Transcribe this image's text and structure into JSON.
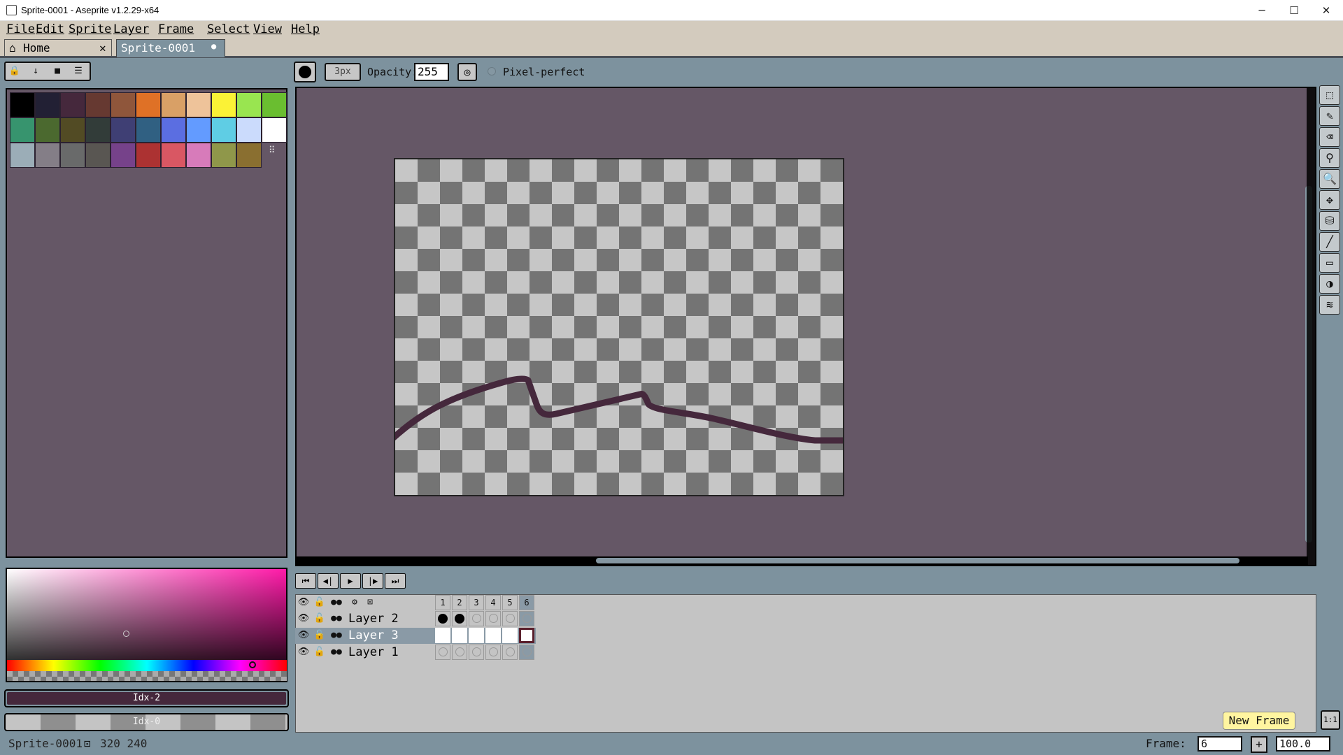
{
  "window": {
    "title": "Sprite-0001 - Aseprite v1.2.29-x64",
    "minimize": "─",
    "maximize": "☐",
    "close": "✕"
  },
  "menu": [
    "File",
    "Edit",
    "Sprite",
    "Layer",
    "Frame",
    "Select",
    "View",
    "Help"
  ],
  "tabs": [
    {
      "label": "Home",
      "icon": "home-icon",
      "close": "✕"
    },
    {
      "label": "Sprite-0001",
      "modified": "●"
    }
  ],
  "toolbar": {
    "brush_size": "3px",
    "opacity_label": "Opacity:",
    "opacity_value": "255",
    "pixel_perfect_label": "Pixel-perfect"
  },
  "palette": {
    "colors": [
      "#000000",
      "#222034",
      "#45283c",
      "#663931",
      "#8f563b",
      "#df7126",
      "#d9a066",
      "#eec39a",
      "#fbf236",
      "#99e550",
      "#6abe30",
      "#37946e",
      "#4b692f",
      "#524b24",
      "#323c39",
      "#3f3f74",
      "#306082",
      "#5b6ee1",
      "#639bff",
      "#5fcde4",
      "#cbdbfc",
      "#ffffff",
      "#9badb7",
      "#847e87",
      "#696a6a",
      "#595652",
      "#76428a",
      "#ac3232",
      "#d95763",
      "#d77bba",
      "#8f974a",
      "#8a6f30"
    ],
    "options_glyph": "⠿"
  },
  "color_bars": {
    "fg_label": "Idx-2",
    "bg_label": "Idx-0",
    "fg_color": "#45283c"
  },
  "timeline": {
    "controls": [
      "⏮",
      "◀|",
      "▶",
      "|▶",
      "⏭"
    ],
    "frames": [
      "1",
      "2",
      "3",
      "4",
      "5",
      "6"
    ],
    "layers": [
      {
        "name": "Layer 2",
        "cels": [
          "filled",
          "filled",
          "empty",
          "empty",
          "empty",
          "empty"
        ]
      },
      {
        "name": "Layer 3",
        "cels": [
          "linked",
          "linked",
          "linked",
          "linked",
          "linked",
          "linked"
        ],
        "selected": true
      },
      {
        "name": "Layer 1",
        "cels": [
          "empty",
          "empty",
          "empty",
          "empty",
          "empty",
          "empty"
        ]
      }
    ]
  },
  "tooltip": "New Frame",
  "status": {
    "sprite": "Sprite-0001",
    "size": "320 240",
    "frame_label": "Frame:",
    "frame_value": "6",
    "zoom": "100.0",
    "new_frame_glyph": "+",
    "ratio": "1:1"
  },
  "tools": [
    "marquee-icon",
    "pencil-icon",
    "eraser-icon",
    "eyedropper-icon",
    "zoom-icon",
    "move-icon",
    "paint-bucket-icon",
    "line-icon",
    "rectangle-icon",
    "contour-icon",
    "blur-icon"
  ],
  "colors": {
    "canvas_bg": "#655766",
    "stroke": "#45283c",
    "accent": "#fff5a0"
  }
}
